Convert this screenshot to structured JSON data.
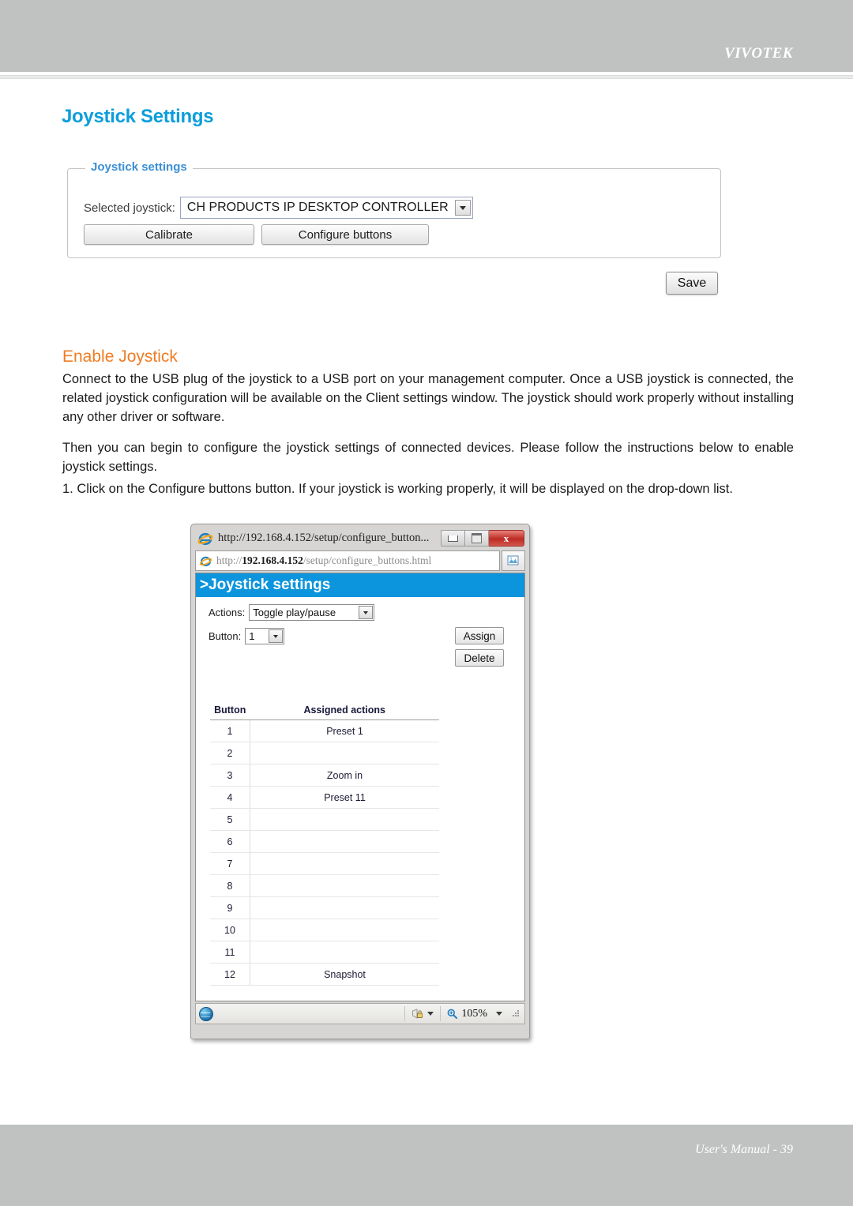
{
  "header": {
    "brand": "VIVOTEK"
  },
  "footer": {
    "text": "User's Manual - 39"
  },
  "page": {
    "title": "Joystick Settings"
  },
  "panel": {
    "legend": "Joystick settings",
    "selected_joystick_label": "Selected joystick:",
    "selected_joystick_value": "CH PRODUCTS IP DESKTOP CONTROLLER",
    "calibrate_label": "Calibrate",
    "configure_buttons_label": "Configure buttons",
    "save_label": "Save"
  },
  "content": {
    "section_heading": "Enable Joystick",
    "paragraph_1": "Connect to the USB plug of the joystick to a USB port on your management computer. Once a USB joystick is connected, the related joystick configuration will be available on the Client settings window. The joystick should work properly without installing any other driver or software.",
    "paragraph_2": "Then you can begin to configure the joystick settings of connected devices. Please follow the instructions below to enable joystick settings.",
    "list_item_1": "1. Click on the Configure buttons button. If your joystick is working properly, it will be displayed on the drop-down list."
  },
  "browser_window": {
    "title": "http://192.168.4.152/setup/configure_button...",
    "address_prefix": "http://",
    "address_host": "192.168.4.152",
    "address_path": "/setup/configure_buttons.html",
    "minimize_label": "",
    "maximize_label": "",
    "close_label": "x",
    "page": {
      "banner": ">Joystick settings",
      "actions_label": "Actions:",
      "actions_value": "Toggle play/pause",
      "button_label": "Button:",
      "button_value": "1",
      "assign_label": "Assign",
      "delete_label": "Delete",
      "table": {
        "headers": [
          "Button",
          "Assigned actions"
        ],
        "rows": [
          [
            "1",
            "Preset 1"
          ],
          [
            "2",
            ""
          ],
          [
            "3",
            "Zoom in"
          ],
          [
            "4",
            "Preset 11"
          ],
          [
            "5",
            ""
          ],
          [
            "6",
            ""
          ],
          [
            "7",
            ""
          ],
          [
            "8",
            ""
          ],
          [
            "9",
            ""
          ],
          [
            "10",
            ""
          ],
          [
            "11",
            ""
          ],
          [
            "12",
            "Snapshot"
          ]
        ]
      }
    },
    "statusbar": {
      "zone_icon": "protected-mode-icon",
      "zoom_level": "105%"
    }
  }
}
